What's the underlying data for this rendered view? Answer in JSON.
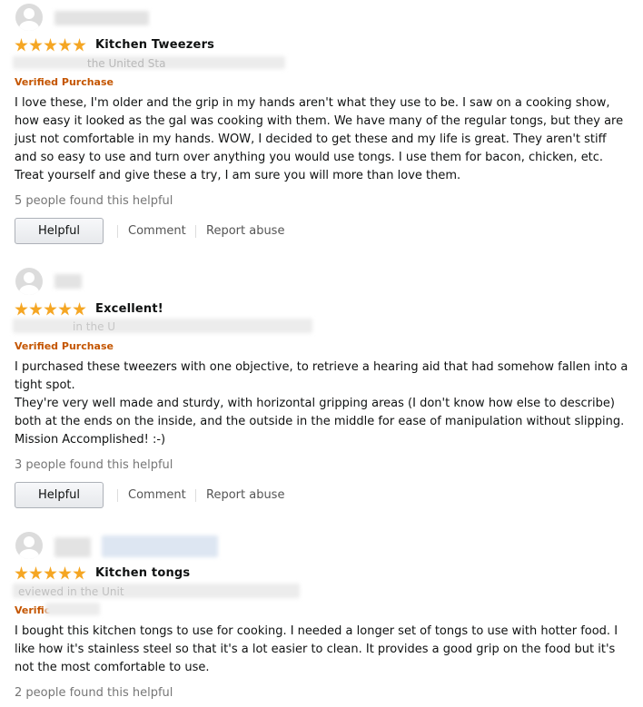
{
  "reviews": [
    {
      "title": "Kitchen Tweezers",
      "rating": 5,
      "badge": "Verified Purchase",
      "date_fragment": "the United Sta",
      "body": "I love these, I'm older and the grip in my hands aren't what they use to be. I saw on a cooking show, how easy it looked as the gal was cooking with them. We have many of the regular tongs, but they are just not comfortable in my hands. WOW, I decided to get these and my life is great. They aren't stiff and so easy to use and turn over anything you would use tongs. I use them for bacon, chicken, etc. Treat yourself and give these a try, I am sure you will more than love them.",
      "helpful_count": "5 people found this helpful",
      "helpful_label": "Helpful",
      "comment_label": "Comment",
      "report_label": "Report abuse"
    },
    {
      "title": "Excellent!",
      "rating": 5,
      "badge": "Verified Purchase",
      "date_fragment": "in the U",
      "body": "I purchased these tweezers with one objective, to retrieve a hearing aid that had somehow fallen into a tight spot.\nThey're very well made and sturdy, with horizontal gripping areas (I don't know how else to describe) both at the ends on the inside, and the outside in the middle for ease of manipulation without slipping. Mission Accomplished! :-)",
      "helpful_count": "3 people found this helpful",
      "helpful_label": "Helpful",
      "comment_label": "Comment",
      "report_label": "Report abuse"
    },
    {
      "title": "Kitchen tongs",
      "rating": 5,
      "badge": "Verific",
      "date_fragment": "eviewed in the Unit",
      "body": "I bought this kitchen tongs to use for cooking. I needed a longer set of tongs to use with hotter food. I like how it's stainless steel so that it's a lot easier to clean. It provides a good grip on the food but it's not the most comfortable to use.",
      "helpful_count": "2 people found this helpful"
    }
  ],
  "colors": {
    "star": "#f5a623",
    "verified": "#c45500",
    "muted": "#767676"
  },
  "icons": {
    "avatar": "avatar-icon",
    "star": "star-icon"
  }
}
